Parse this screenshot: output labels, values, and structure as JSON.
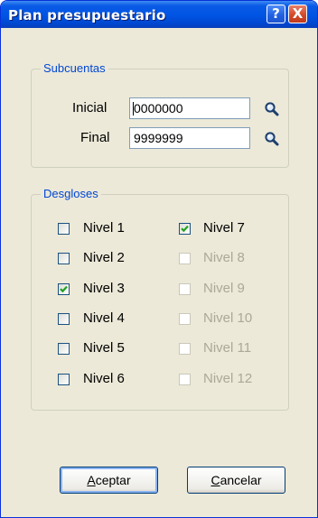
{
  "window": {
    "title": "Plan presupuestario",
    "help_glyph": "?",
    "close_glyph": "X"
  },
  "subcuentas": {
    "legend": "Subcuentas",
    "initial_label": "Inicial",
    "initial_value": "0000000",
    "final_label": "Final",
    "final_value": "9999999",
    "search_icon": "magnifier-icon"
  },
  "desgloses": {
    "legend": "Desgloses",
    "levels": [
      {
        "label": "Nivel 1",
        "checked": false,
        "enabled": true
      },
      {
        "label": "Nivel 2",
        "checked": false,
        "enabled": true
      },
      {
        "label": "Nivel 3",
        "checked": true,
        "enabled": true
      },
      {
        "label": "Nivel 4",
        "checked": false,
        "enabled": true
      },
      {
        "label": "Nivel 5",
        "checked": false,
        "enabled": true
      },
      {
        "label": "Nivel 6",
        "checked": false,
        "enabled": true
      },
      {
        "label": "Nivel 7",
        "checked": true,
        "enabled": true
      },
      {
        "label": "Nivel 8",
        "checked": false,
        "enabled": false
      },
      {
        "label": "Nivel 9",
        "checked": false,
        "enabled": false
      },
      {
        "label": "Nivel 10",
        "checked": false,
        "enabled": false
      },
      {
        "label": "Nivel 11",
        "checked": false,
        "enabled": false
      },
      {
        "label": "Nivel 12",
        "checked": false,
        "enabled": false
      }
    ]
  },
  "buttons": {
    "accept_mnemonic": "A",
    "accept_rest": "ceptar",
    "cancel_mnemonic": "C",
    "cancel_rest": "ancelar"
  },
  "colors": {
    "titlebar": "#0054E3",
    "dialog_bg": "#ECE9D8",
    "legend_text": "#0046D5",
    "checkmark": "#21A121",
    "disabled_text": "#ACA899",
    "close_button": "#D4492A"
  }
}
